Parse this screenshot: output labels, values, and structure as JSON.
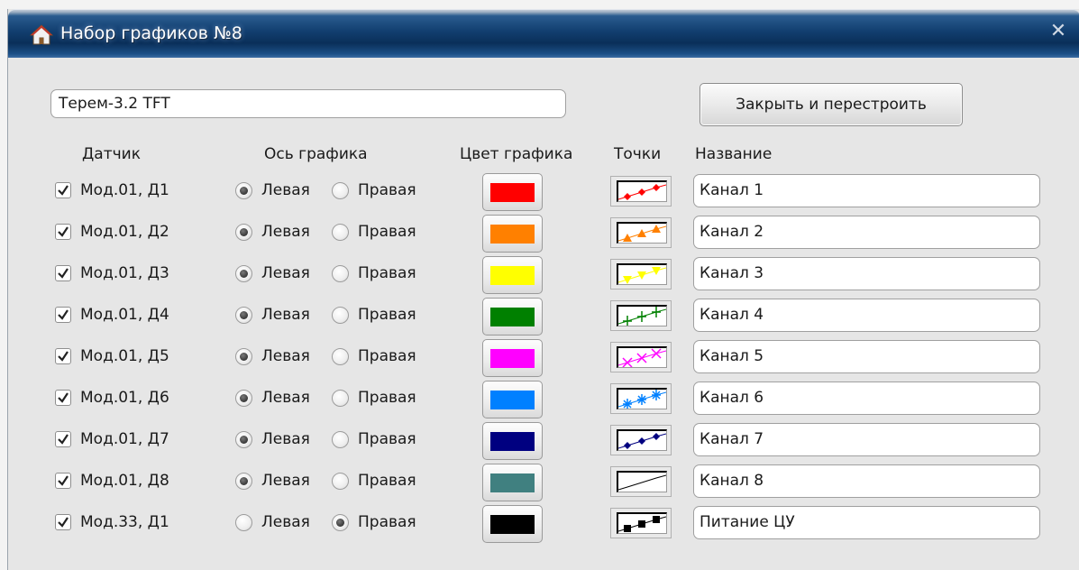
{
  "window": {
    "title": "Набор графиков №8",
    "close_glyph": "✕",
    "icon": "home-icon"
  },
  "set_name": "Терем-3.2 TFT",
  "rebuild_button": "Закрыть и перестроить",
  "headers": {
    "sensor": "Датчик",
    "axis": "Ось графика",
    "color": "Цвет графика",
    "points": "Точки",
    "name": "Название"
  },
  "rows": [
    {
      "sensor": "Мод.01, Д1",
      "checked": true,
      "axis_left": "Левая",
      "axis_right": "Правая",
      "axis": "left",
      "color": "#ff0000",
      "points": "diamond",
      "name": "Канал 1"
    },
    {
      "sensor": "Мод.01, Д2",
      "checked": true,
      "axis_left": "Левая",
      "axis_right": "Правая",
      "axis": "left",
      "color": "#ff8000",
      "points": "triangle-up",
      "name": "Канал 2"
    },
    {
      "sensor": "Мод.01, Д3",
      "checked": true,
      "axis_left": "Левая",
      "axis_right": "Правая",
      "axis": "left",
      "color": "#ffff00",
      "points": "triangle-down",
      "name": "Канал 3"
    },
    {
      "sensor": "Мод.01, Д4",
      "checked": true,
      "axis_left": "Левая",
      "axis_right": "Правая",
      "axis": "left",
      "color": "#008000",
      "points": "plus",
      "name": "Канал 4"
    },
    {
      "sensor": "Мод.01, Д5",
      "checked": true,
      "axis_left": "Левая",
      "axis_right": "Правая",
      "axis": "left",
      "color": "#ff00ff",
      "points": "cross",
      "name": "Канал 5"
    },
    {
      "sensor": "Мод.01, Д6",
      "checked": true,
      "axis_left": "Левая",
      "axis_right": "Правая",
      "axis": "left",
      "color": "#0080ff",
      "points": "asterisk",
      "name": "Канал 6"
    },
    {
      "sensor": "Мод.01, Д7",
      "checked": true,
      "axis_left": "Левая",
      "axis_right": "Правая",
      "axis": "left",
      "color": "#000080",
      "points": "diamond",
      "name": "Канал 7"
    },
    {
      "sensor": "Мод.01, Д8",
      "checked": true,
      "axis_left": "Левая",
      "axis_right": "Правая",
      "axis": "left",
      "color": "#408080",
      "points": "none",
      "name": "Канал 8"
    },
    {
      "sensor": "Мод.33, Д1",
      "checked": true,
      "axis_left": "Левая",
      "axis_right": "Правая",
      "axis": "right",
      "color": "#000000",
      "points": "square",
      "name": "Питание ЦУ"
    }
  ]
}
